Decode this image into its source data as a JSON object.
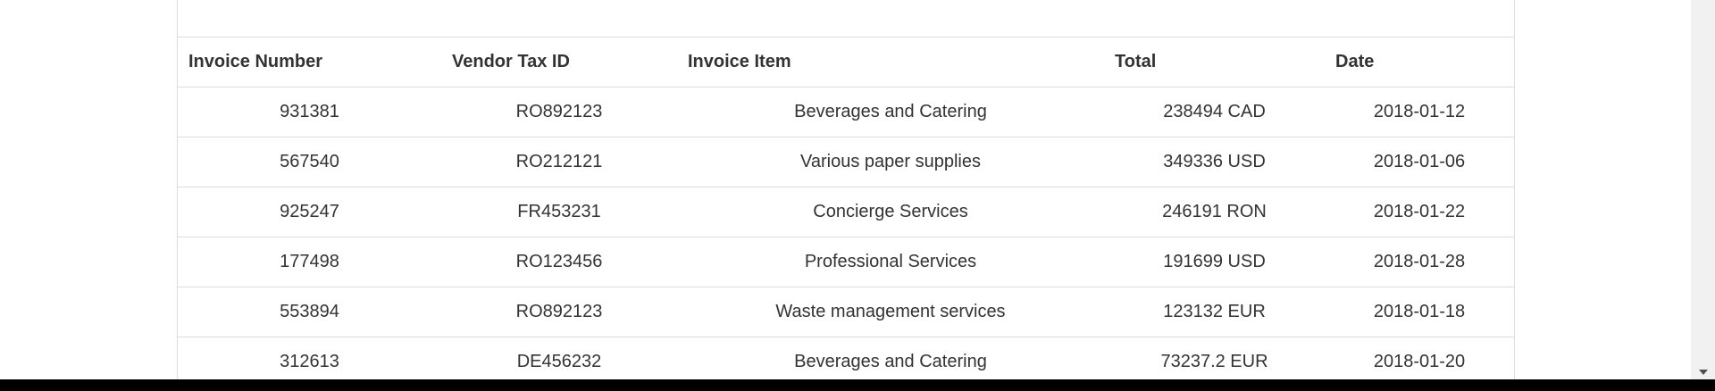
{
  "table": {
    "headers": [
      "Invoice Number",
      "Vendor Tax ID",
      "Invoice Item",
      "Total",
      "Date"
    ],
    "rows": [
      [
        "931381",
        "RO892123",
        "Beverages and Catering",
        "238494 CAD",
        "2018-01-12"
      ],
      [
        "567540",
        "RO212121",
        "Various paper supplies",
        "349336 USD",
        "2018-01-06"
      ],
      [
        "925247",
        "FR453231",
        "Concierge Services",
        "246191 RON",
        "2018-01-22"
      ],
      [
        "177498",
        "RO123456",
        "Professional Services",
        "191699 USD",
        "2018-01-28"
      ],
      [
        "553894",
        "RO892123",
        "Waste management services",
        "123132 EUR",
        "2018-01-18"
      ],
      [
        "312613",
        "DE456232",
        "Beverages and Catering",
        "73237.2 EUR",
        "2018-01-20"
      ]
    ]
  },
  "icons": {
    "scroll_down": "chevron-down-icon"
  }
}
